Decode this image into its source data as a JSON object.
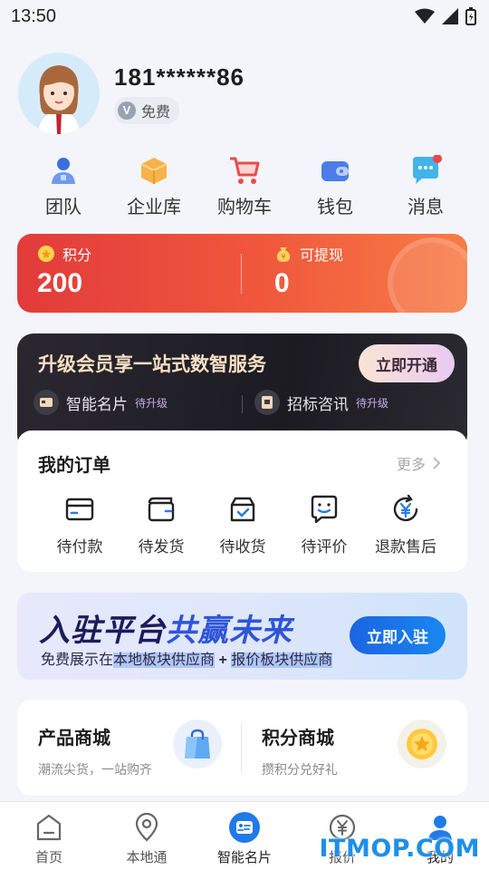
{
  "status_bar": {
    "time": "13:50"
  },
  "profile": {
    "phone": "181******86",
    "badge_icon": "V",
    "badge_label": "免费"
  },
  "quick_nav": [
    {
      "label": "团队",
      "icon": "team-icon"
    },
    {
      "label": "企业库",
      "icon": "box-icon"
    },
    {
      "label": "购物车",
      "icon": "cart-icon"
    },
    {
      "label": "钱包",
      "icon": "wallet-icon"
    },
    {
      "label": "消息",
      "icon": "message-icon"
    }
  ],
  "points": {
    "points_label": "积分",
    "points_value": "200",
    "withdraw_label": "可提现",
    "withdraw_value": "0"
  },
  "vip": {
    "title": "升级会员享一站式数智服务",
    "button": "立即开通",
    "items": [
      {
        "label": "智能名片",
        "tag": "待升级"
      },
      {
        "label": "招标咨讯",
        "tag": "待升级"
      }
    ]
  },
  "orders": {
    "title": "我的订单",
    "more": "更多",
    "items": [
      {
        "label": "待付款",
        "icon": "card-icon"
      },
      {
        "label": "待发货",
        "icon": "wallet-out-icon"
      },
      {
        "label": "待收货",
        "icon": "box-check-icon"
      },
      {
        "label": "待评价",
        "icon": "smile-chat-icon"
      },
      {
        "label": "退款售后",
        "icon": "yuan-refund-icon"
      }
    ]
  },
  "banner": {
    "title_a": "入驻平台",
    "title_b": "共赢未来",
    "sub_a": "免费展示在",
    "sub_b": "本地板块供应商",
    "sub_c": "+",
    "sub_d": "报价板块供应商",
    "button": "立即入驻"
  },
  "mall": [
    {
      "title": "产品商城",
      "sub": "潮流尖货，一站购齐"
    },
    {
      "title": "积分商城",
      "sub": "攒积分兑好礼"
    }
  ],
  "bottom_nav": [
    {
      "label": "首页"
    },
    {
      "label": "本地通"
    },
    {
      "label": "智能名片"
    },
    {
      "label": "报价"
    },
    {
      "label": "我的"
    }
  ],
  "watermark": "ITMOP.COM",
  "colors": {
    "accent_red": "#e23b3b",
    "accent_blue": "#1c64e2",
    "vip_dark": "#1c1b22"
  }
}
